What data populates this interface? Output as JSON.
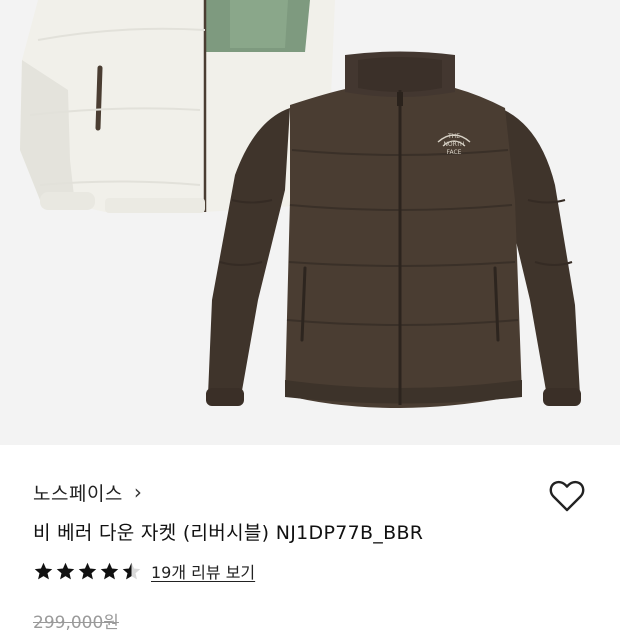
{
  "product": {
    "brand": "노스페이스",
    "brand_chevron": "›",
    "title": "비 베러 다운 자켓 (리버시블) NJ1DP77B_BBR",
    "rating": 4.5,
    "review_link": "19개 리뷰 보기",
    "original_price": "299,000원"
  },
  "image": {
    "logo_lines": [
      "THE",
      "NORTH",
      "FACE"
    ],
    "colors": {
      "background": "#f3f3f3",
      "jacket_brown": "#4a3d32",
      "jacket_white": "#f1f0ea",
      "fleece_green": "#7e9a7f"
    }
  },
  "colors": {
    "star": "#111111",
    "text": "#222222",
    "strike_price": "#9a9a9a"
  },
  "icons": {
    "heart": "heart-outline-icon",
    "chevron": "chevron-right-icon",
    "star": "star-icon"
  }
}
